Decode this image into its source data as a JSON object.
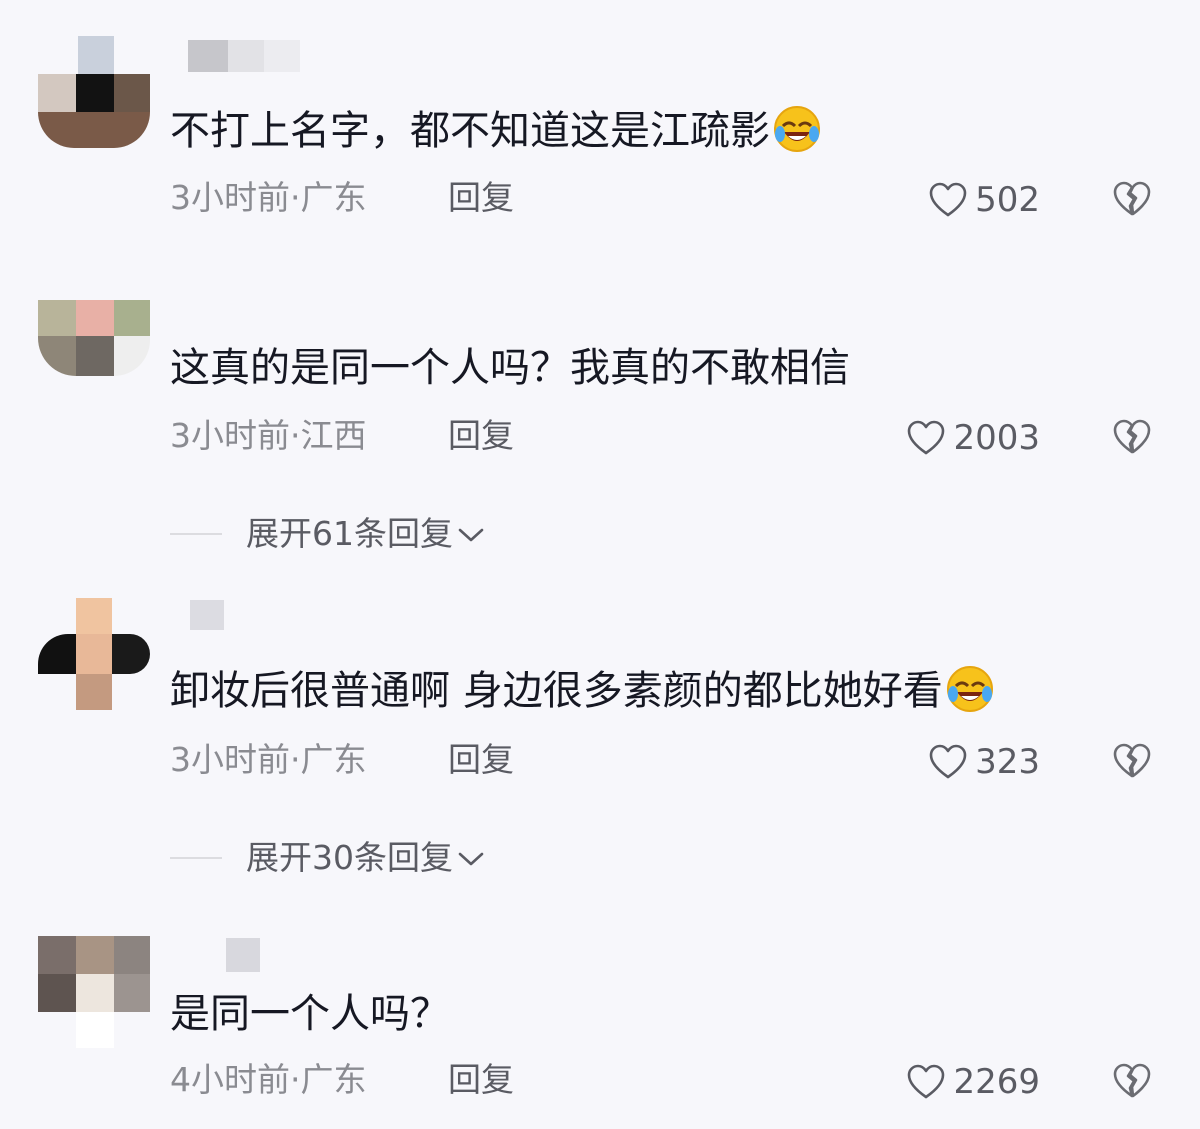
{
  "comments": [
    {
      "text": "不打上名字，都不知道这是江疏影",
      "emoji": "grinning-tears-emoji",
      "time_location": "3小时前·广东",
      "reply_label": "回复",
      "likes": "502"
    },
    {
      "text": "这真的是同一个人吗？我真的不敢相信",
      "emoji": "",
      "time_location": "3小时前·江西",
      "reply_label": "回复",
      "likes": "2003",
      "expand_label": "展开61条回复"
    },
    {
      "text": "卸妆后很普通啊 身边很多素颜的都比她好看",
      "emoji": "grinning-tears-emoji",
      "time_location": "3小时前·广东",
      "reply_label": "回复",
      "likes": "323",
      "expand_label": "展开30条回复"
    },
    {
      "text": "是同一个人吗？",
      "emoji": "",
      "time_location": "4小时前·广东",
      "reply_label": "回复",
      "likes": "2269"
    }
  ],
  "icons": {
    "like": "heart-outline-icon",
    "dislike": "broken-heart-icon",
    "expand": "chevron-down-icon"
  },
  "colors": {
    "background": "#f7f7fb",
    "primary_text": "#161823",
    "secondary_text": "#8a8b91"
  }
}
